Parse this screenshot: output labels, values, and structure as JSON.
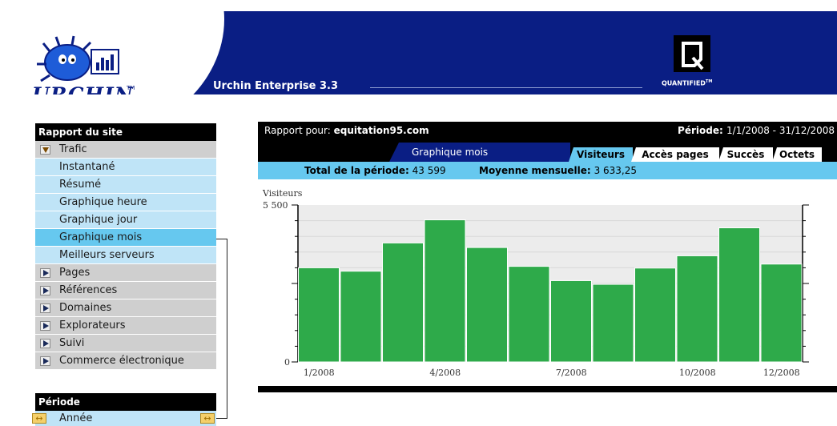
{
  "header": {
    "brand": "URCHIN",
    "brand_tm": "TM",
    "product": "Urchin Enterprise 3.3",
    "partner": "QUANTIFIED",
    "partner_tm": "TM"
  },
  "sidebar": {
    "report_heading": "Rapport du site",
    "items": [
      {
        "label": "Trafic",
        "type": "group",
        "icon": "expanded-triangle-icon"
      },
      {
        "label": "Instantané",
        "type": "sub"
      },
      {
        "label": "Résumé",
        "type": "sub"
      },
      {
        "label": "Graphique heure",
        "type": "sub"
      },
      {
        "label": "Graphique jour",
        "type": "sub"
      },
      {
        "label": "Graphique mois",
        "type": "sub",
        "selected": true
      },
      {
        "label": "Meilleurs serveurs",
        "type": "sub"
      },
      {
        "label": "Pages",
        "type": "group",
        "icon": "collapsed-triangle-icon"
      },
      {
        "label": "Références",
        "type": "group",
        "icon": "collapsed-triangle-icon"
      },
      {
        "label": "Domaines",
        "type": "group",
        "icon": "collapsed-triangle-icon"
      },
      {
        "label": "Explorateurs",
        "type": "group",
        "icon": "collapsed-triangle-icon"
      },
      {
        "label": "Suivi",
        "type": "group",
        "icon": "collapsed-triangle-icon"
      },
      {
        "label": "Commerce électronique",
        "type": "group",
        "icon": "collapsed-triangle-icon"
      }
    ],
    "period_heading": "Période",
    "period_item": "Année"
  },
  "report": {
    "site_label": "Rapport pour:",
    "site": "equitation95.com",
    "period_label": "Période:",
    "period": "1/1/2008 - 31/12/2008",
    "view_tab": "Graphique mois",
    "metric_tabs": [
      "Visiteurs",
      "Accès pages",
      "Succès",
      "Octets"
    ],
    "active_metric": "Visiteurs",
    "total_label": "Total de la période:",
    "total_value": "43 599",
    "avg_label": "Moyenne mensuelle:",
    "avg_value": "3 633,25"
  },
  "colors": {
    "header_bg": "#0a1e84",
    "accent_blue": "#66c8ef",
    "light_blue": "#bfe4f7",
    "bar_green": "#2eaa4a",
    "menu_gray": "#cfcfcf"
  },
  "chart_data": {
    "type": "bar",
    "ylabel": "Visiteurs",
    "ylim": [
      0,
      5500
    ],
    "ytick_labels": [
      "5 500",
      "0"
    ],
    "categories": [
      "1/2008",
      "2/2008",
      "3/2008",
      "4/2008",
      "5/2008",
      "6/2008",
      "7/2008",
      "8/2008",
      "9/2008",
      "10/2008",
      "11/2008",
      "12/2008"
    ],
    "xtick_labels": [
      "1/2008",
      "4/2008",
      "7/2008",
      "10/2008",
      "12/2008"
    ],
    "values": [
      3300,
      3180,
      4170,
      4980,
      4010,
      3350,
      2850,
      2720,
      3290,
      3720,
      4700,
      3430
    ],
    "grid": true
  }
}
